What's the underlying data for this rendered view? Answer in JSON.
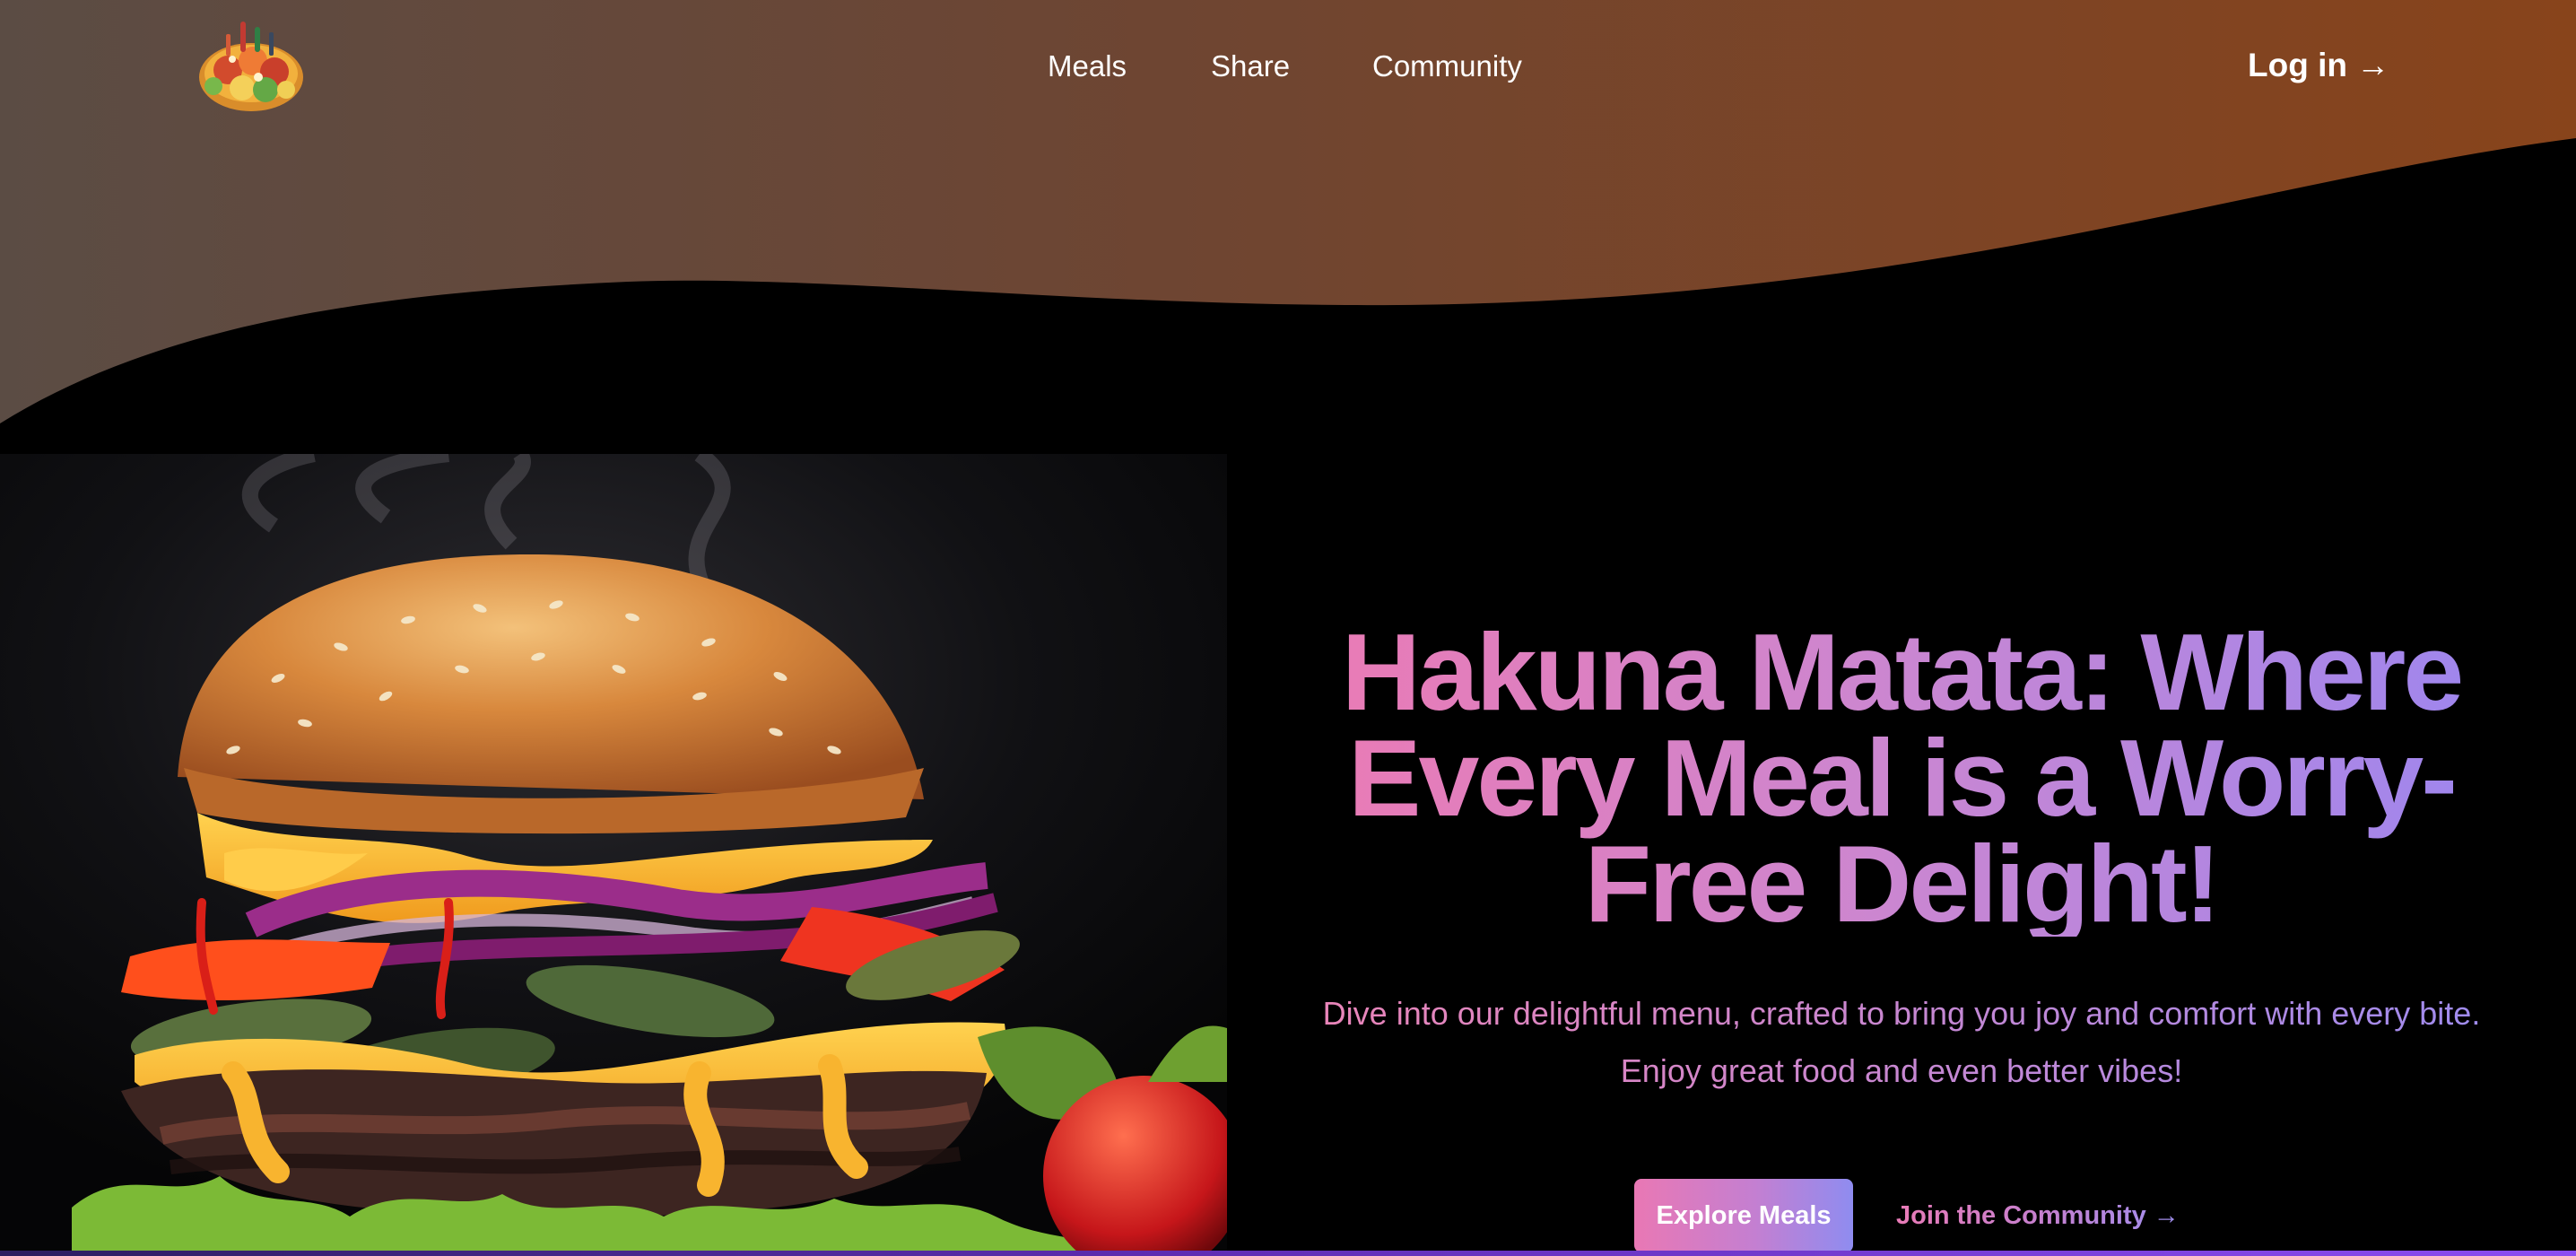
{
  "header": {
    "logo_icon": "food-platter-logo-icon",
    "nav": [
      {
        "label": "Meals"
      },
      {
        "label": "Share"
      },
      {
        "label": "Community"
      }
    ],
    "login_label": "Log in →"
  },
  "hero": {
    "image_icon": "burger-image",
    "title": "Hakuna Matata: Where Every Meal is a Worry-Free Delight!",
    "subtitle": "Dive into our delightful menu, crafted to bring you joy and comfort with every bite. Enjoy great food and even better vibes!",
    "primary_button_label": "Explore Meals",
    "secondary_link_label": "Join the Community →"
  },
  "colors": {
    "header_gradient_start": "#5a4a42",
    "header_gradient_end": "#8b4518",
    "title_gradient_start": "#ec7ab3",
    "title_gradient_end": "#9b86f0",
    "background": "#000000",
    "bottom_accent": "#8c4df1"
  }
}
